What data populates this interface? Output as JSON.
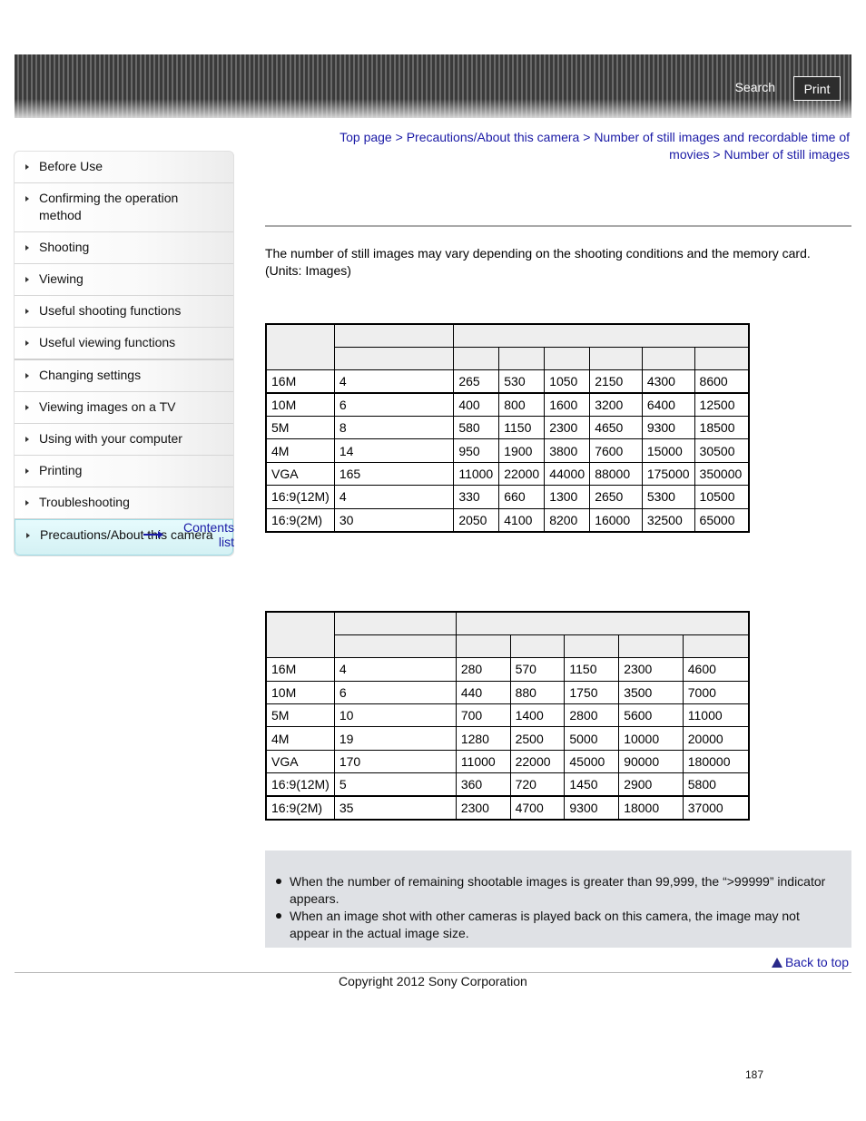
{
  "header": {
    "search_label": "Search",
    "print_label": "Print"
  },
  "sidebar": {
    "items": [
      {
        "label": "Before Use"
      },
      {
        "label": "Confirming the operation method"
      },
      {
        "label": "Shooting"
      },
      {
        "label": "Viewing"
      },
      {
        "label": "Useful shooting functions"
      },
      {
        "label": "Useful viewing functions"
      },
      {
        "label": "Changing settings"
      },
      {
        "label": "Viewing images on a TV"
      },
      {
        "label": "Using with your computer"
      },
      {
        "label": "Printing"
      },
      {
        "label": "Troubleshooting"
      },
      {
        "label": "Precautions/About this camera",
        "active": true
      }
    ],
    "contents_list_label": "Contents list"
  },
  "breadcrumb": {
    "items": [
      "Top page",
      "Precautions/About this camera",
      "Number of still images and recordable time of movies",
      "Number of still images"
    ],
    "separator": ">"
  },
  "intro": {
    "line1": "The number of still images may vary depending on the shooting conditions and the memory card.",
    "line2": "(Units: Images)"
  },
  "table1": {
    "rows": [
      [
        "16M",
        "4",
        "265",
        "530",
        "1050",
        "2150",
        "4300",
        "8600"
      ],
      [
        "10M",
        "6",
        "400",
        "800",
        "1600",
        "3200",
        "6400",
        "12500"
      ],
      [
        "5M",
        "8",
        "580",
        "1150",
        "2300",
        "4650",
        "9300",
        "18500"
      ],
      [
        "4M",
        "14",
        "950",
        "1900",
        "3800",
        "7600",
        "15000",
        "30500"
      ],
      [
        "VGA",
        "165",
        "11000",
        "22000",
        "44000",
        "88000",
        "175000",
        "350000"
      ],
      [
        "16:9(12M)",
        "4",
        "330",
        "660",
        "1300",
        "2650",
        "5300",
        "10500"
      ],
      [
        "16:9(2M)",
        "30",
        "2050",
        "4100",
        "8200",
        "16000",
        "32500",
        "65000"
      ]
    ]
  },
  "table2": {
    "rows": [
      [
        "16M",
        "4",
        "280",
        "570",
        "1150",
        "2300",
        "4600"
      ],
      [
        "10M",
        "6",
        "440",
        "880",
        "1750",
        "3500",
        "7000"
      ],
      [
        "5M",
        "10",
        "700",
        "1400",
        "2800",
        "5600",
        "11000"
      ],
      [
        "4M",
        "19",
        "1280",
        "2500",
        "5000",
        "10000",
        "20000"
      ],
      [
        "VGA",
        "170",
        "11000",
        "22000",
        "45000",
        "90000",
        "180000"
      ],
      [
        "16:9(12M)",
        "5",
        "360",
        "720",
        "1450",
        "2900",
        "5800"
      ],
      [
        "16:9(2M)",
        "35",
        "2300",
        "4700",
        "9300",
        "18000",
        "37000"
      ]
    ]
  },
  "notes": [
    "When the number of remaining shootable images is greater than 99,999, the “>99999” indicator appears.",
    "When an image shot with other cameras is played back on this camera, the image may not appear in the actual image size."
  ],
  "footer": {
    "back_to_top_label": "Back to top",
    "copyright": "Copyright 2012 Sony Corporation",
    "page_number": "187"
  }
}
